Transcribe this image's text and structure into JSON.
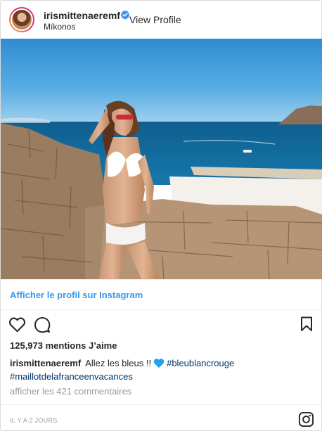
{
  "header": {
    "username": "irismittenaeremf",
    "view_profile_label": "View Profile",
    "location": "Míkonos",
    "verified": true
  },
  "post": {
    "view_on_instagram_label": "Afficher le profil sur Instagram",
    "likes_text": "125,973 mentions J’aime",
    "caption": {
      "username": "irismittenaeremf",
      "text": "Allez les bleus !!",
      "hashtag_1": "#bleublancrouge",
      "hashtag_2": "#maillotdelafranceenvacances"
    },
    "comments_link": "afficher les 421 commentaires",
    "timestamp": "IL Y A 2 JOURS"
  },
  "icons": {
    "like": "heart-outline-icon",
    "comment": "comment-bubble-icon",
    "save": "bookmark-icon",
    "instagram": "instagram-logo-icon",
    "verified": "verified-badge-icon",
    "caption_emoji": "blue-heart-emoji"
  },
  "colors": {
    "link_blue": "#3897f0",
    "hashtag": "#003569",
    "verified_badge": "#3897f0",
    "emoji_heart": "#1da1f2",
    "muted_text": "#999999"
  }
}
